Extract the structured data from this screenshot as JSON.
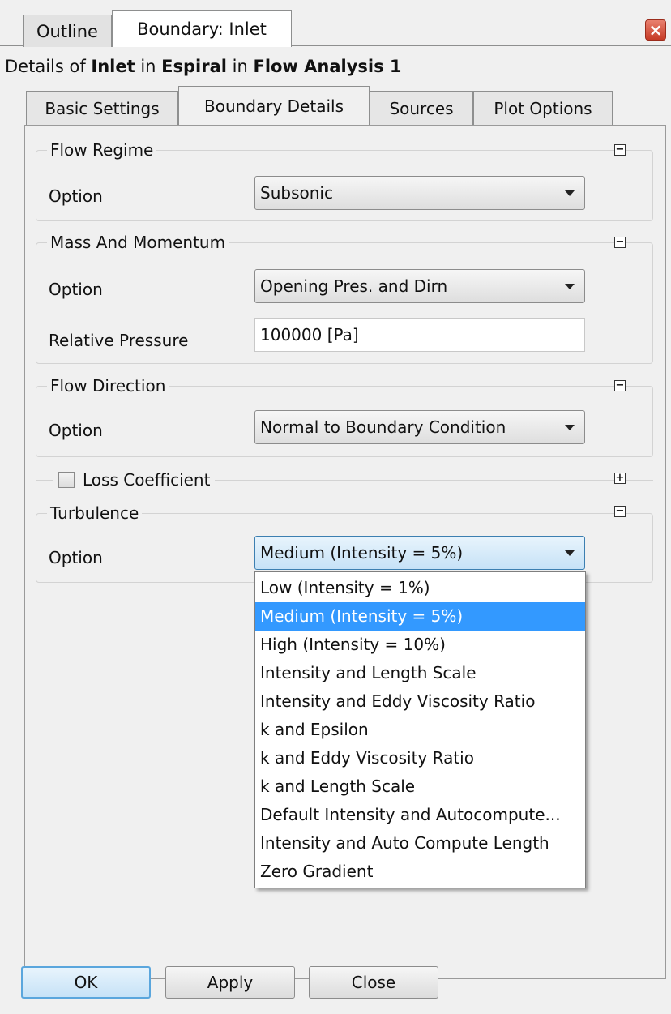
{
  "tabs": {
    "outline": "Outline",
    "boundary": "Boundary: Inlet"
  },
  "details": {
    "prefix": "Details of ",
    "object": "Inlet",
    "in1": " in ",
    "domain": "Espiral",
    "in2": " in ",
    "analysis": "Flow Analysis 1"
  },
  "subtabs": [
    "Basic Settings",
    "Boundary Details",
    "Sources",
    "Plot Options"
  ],
  "flow_regime": {
    "title": "Flow Regime",
    "option_label": "Option",
    "option_value": "Subsonic"
  },
  "mass_momentum": {
    "title": "Mass And Momentum",
    "option_label": "Option",
    "option_value": "Opening Pres. and Dirn",
    "pressure_label": "Relative Pressure",
    "pressure_value": "100000 [Pa]"
  },
  "flow_direction": {
    "title": "Flow Direction",
    "option_label": "Option",
    "option_value": "Normal to Boundary Condition"
  },
  "loss_coefficient": {
    "title": "Loss Coefficient",
    "checked": false
  },
  "turbulence": {
    "title": "Turbulence",
    "option_label": "Option",
    "option_value": "Medium (Intensity = 5%)",
    "options": [
      "Low (Intensity = 1%)",
      "Medium (Intensity = 5%)",
      "High (Intensity = 10%)",
      "Intensity and Length Scale",
      "Intensity and Eddy Viscosity Ratio",
      "k and Epsilon",
      "k and Eddy Viscosity Ratio",
      "k and Length Scale",
      "Default Intensity and Autocompute...",
      "Intensity and Auto Compute Length",
      "Zero Gradient"
    ],
    "selected_index": 1
  },
  "buttons": {
    "ok": "OK",
    "apply": "Apply",
    "close": "Close"
  },
  "icons": {
    "close": "close-icon",
    "collapse": "collapse-icon",
    "expand": "expand-icon",
    "dropdown": "chevron-down-icon"
  },
  "colors": {
    "selection": "#3399ff",
    "close_button": "#d0432e",
    "focus_border": "#3c7fb1"
  }
}
